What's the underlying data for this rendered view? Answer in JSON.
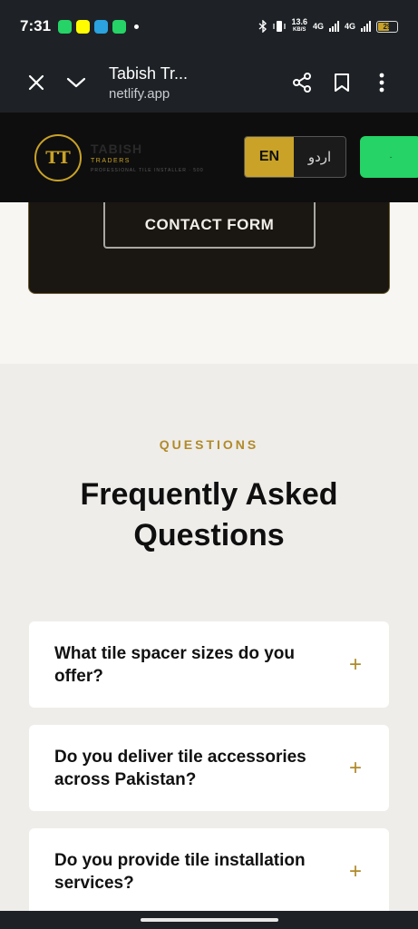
{
  "status_bar": {
    "time": "7:31",
    "network_speed_value": "13.6",
    "network_speed_unit": "KB/S",
    "network_1": "4G",
    "network_2": "4G",
    "battery": "29"
  },
  "browser": {
    "title": "Tabish Tr...",
    "url": "netlify.app"
  },
  "site_header": {
    "logo": "TT",
    "brand_name": "TABISH",
    "brand_sub": "TRADERS",
    "brand_tagline": "PROFESSIONAL TILE INSTALLER · 500",
    "lang_en": "EN",
    "lang_ur": "اردو",
    "whatsapp_label": "·"
  },
  "cta": {
    "contact_button": "CONTACT FORM"
  },
  "faq": {
    "eyebrow": "QUESTIONS",
    "title_line1": "Frequently Asked",
    "title_line2": "Questions",
    "items": [
      {
        "question_line1": "What tile spacer sizes do you",
        "question_line2": "offer?",
        "toggle": "+"
      },
      {
        "question_line1": "Do you deliver tile accessories",
        "question_line2": "across Pakistan?",
        "toggle": "+"
      },
      {
        "question_line1": "Do you provide tile installation",
        "question_line2": "services?",
        "toggle": "+"
      }
    ]
  },
  "colors": {
    "accent_gold": "#c9a227",
    "whatsapp_green": "#25d366",
    "dark_bg": "#0e0e0e",
    "faq_bg": "#efedea"
  }
}
